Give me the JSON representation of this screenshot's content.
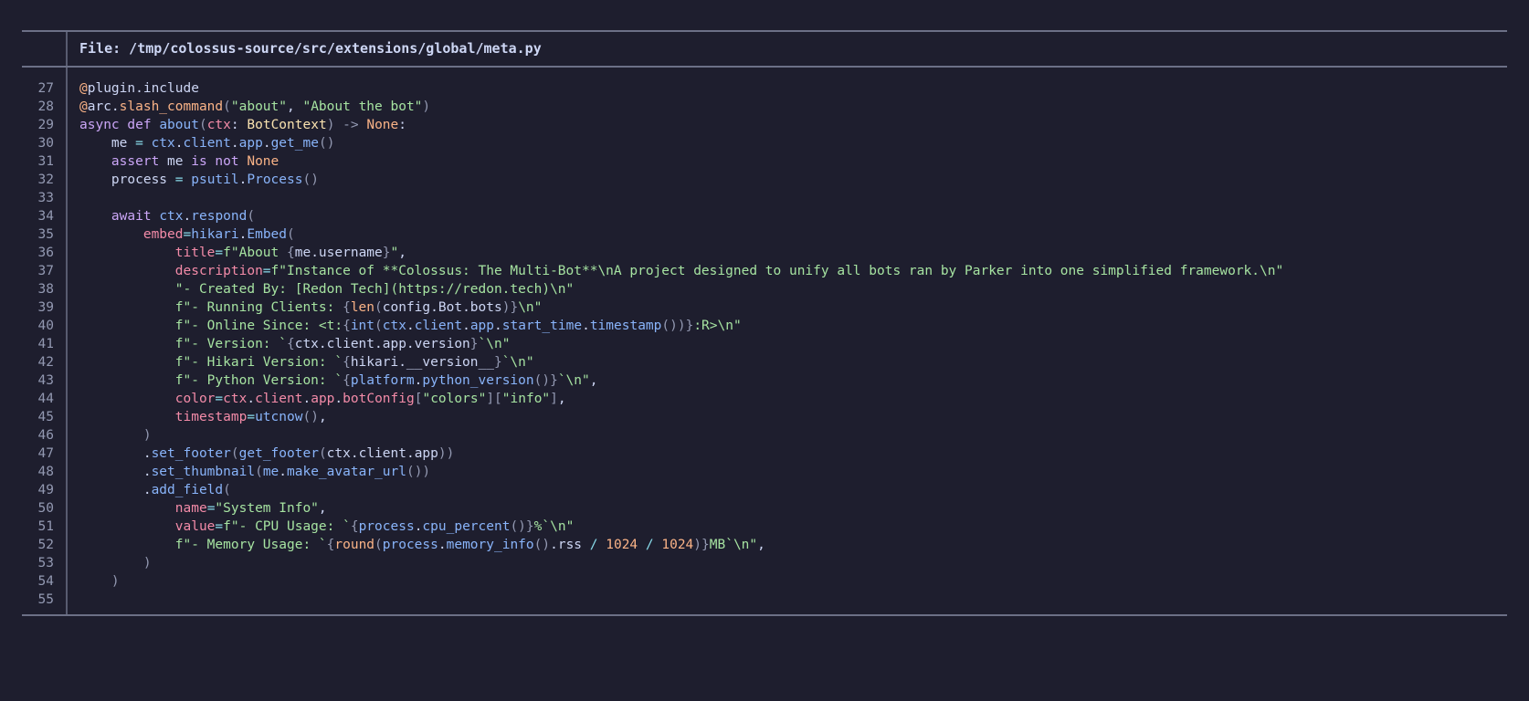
{
  "header": {
    "file_label": "File: /tmp/colossus-source/src/extensions/global/meta.py"
  },
  "code": [
    {
      "n": "27",
      "tokens": [
        [
          "@",
          "deco"
        ],
        [
          "plugin.include",
          "text"
        ]
      ]
    },
    {
      "n": "28",
      "tokens": [
        [
          "@",
          "deco"
        ],
        [
          "arc.",
          "text"
        ],
        [
          "slash_command",
          "deco"
        ],
        [
          "(",
          "punc"
        ],
        [
          "\"about\"",
          "str"
        ],
        [
          ", ",
          "text"
        ],
        [
          "\"About the bot\"",
          "str"
        ],
        [
          ")",
          "punc"
        ]
      ]
    },
    {
      "n": "29",
      "tokens": [
        [
          "async def ",
          "kw"
        ],
        [
          "about",
          "fn"
        ],
        [
          "(",
          "punc"
        ],
        [
          "ctx",
          "param"
        ],
        [
          ": ",
          "text"
        ],
        [
          "BotContext",
          "type"
        ],
        [
          ") -> ",
          "punc"
        ],
        [
          "None",
          "const"
        ],
        [
          ":",
          "text"
        ]
      ]
    },
    {
      "n": "30",
      "tokens": [
        [
          "    me ",
          "text"
        ],
        [
          "= ",
          "op"
        ],
        [
          "ctx",
          "attr"
        ],
        [
          ".",
          "text"
        ],
        [
          "client",
          "attr"
        ],
        [
          ".",
          "text"
        ],
        [
          "app",
          "attr"
        ],
        [
          ".",
          "text"
        ],
        [
          "get_me",
          "fn"
        ],
        [
          "()",
          "punc"
        ]
      ]
    },
    {
      "n": "31",
      "tokens": [
        [
          "    ",
          "text"
        ],
        [
          "assert ",
          "kw"
        ],
        [
          "me ",
          "text"
        ],
        [
          "is not ",
          "kw"
        ],
        [
          "None",
          "const"
        ]
      ]
    },
    {
      "n": "32",
      "tokens": [
        [
          "    process ",
          "text"
        ],
        [
          "= ",
          "op"
        ],
        [
          "psutil",
          "attr"
        ],
        [
          ".",
          "text"
        ],
        [
          "Process",
          "fn"
        ],
        [
          "()",
          "punc"
        ]
      ]
    },
    {
      "n": "33",
      "tokens": []
    },
    {
      "n": "34",
      "tokens": [
        [
          "    ",
          "text"
        ],
        [
          "await ",
          "kw"
        ],
        [
          "ctx",
          "attr"
        ],
        [
          ".",
          "text"
        ],
        [
          "respond",
          "fn"
        ],
        [
          "(",
          "punc"
        ]
      ]
    },
    {
      "n": "35",
      "tokens": [
        [
          "        ",
          "text"
        ],
        [
          "embed",
          "param"
        ],
        [
          "=",
          "op"
        ],
        [
          "hikari",
          "attr"
        ],
        [
          ".",
          "text"
        ],
        [
          "Embed",
          "fn"
        ],
        [
          "(",
          "punc"
        ]
      ]
    },
    {
      "n": "36",
      "tokens": [
        [
          "            ",
          "text"
        ],
        [
          "title",
          "param"
        ],
        [
          "=",
          "op"
        ],
        [
          "f\"About ",
          "str"
        ],
        [
          "{",
          "punc"
        ],
        [
          "me.username",
          "text"
        ],
        [
          "}",
          "punc"
        ],
        [
          "\"",
          "str"
        ],
        [
          ",",
          "text"
        ]
      ]
    },
    {
      "n": "37",
      "tokens": [
        [
          "            ",
          "text"
        ],
        [
          "description",
          "param"
        ],
        [
          "=",
          "op"
        ],
        [
          "f\"Instance of **Colossus: The Multi-Bot**\\nA project designed to unify all bots ran by Parker into one simplified framework.\\n\"",
          "str"
        ]
      ]
    },
    {
      "n": "38",
      "tokens": [
        [
          "            ",
          "text"
        ],
        [
          "\"- Created By: [Redon Tech](https://redon.tech)\\n\"",
          "str"
        ]
      ]
    },
    {
      "n": "39",
      "tokens": [
        [
          "            ",
          "text"
        ],
        [
          "f\"- Running Clients: ",
          "str"
        ],
        [
          "{",
          "punc"
        ],
        [
          "len",
          "builtin"
        ],
        [
          "(",
          "punc"
        ],
        [
          "config.Bot.bots",
          "text"
        ],
        [
          ")}",
          "punc"
        ],
        [
          "\\n\"",
          "str"
        ]
      ]
    },
    {
      "n": "40",
      "tokens": [
        [
          "            ",
          "text"
        ],
        [
          "f\"- Online Since: <t:",
          "str"
        ],
        [
          "{",
          "punc"
        ],
        [
          "int",
          "fn"
        ],
        [
          "(",
          "punc"
        ],
        [
          "ctx",
          "attr"
        ],
        [
          ".",
          "text"
        ],
        [
          "client",
          "attr"
        ],
        [
          ".",
          "text"
        ],
        [
          "app",
          "attr"
        ],
        [
          ".",
          "text"
        ],
        [
          "start_time",
          "attr"
        ],
        [
          ".",
          "text"
        ],
        [
          "timestamp",
          "fn"
        ],
        [
          "())}",
          "punc"
        ],
        [
          ":R>\\n\"",
          "str"
        ]
      ]
    },
    {
      "n": "41",
      "tokens": [
        [
          "            ",
          "text"
        ],
        [
          "f\"- Version: `",
          "str"
        ],
        [
          "{",
          "punc"
        ],
        [
          "ctx.client.app.version",
          "text"
        ],
        [
          "}",
          "punc"
        ],
        [
          "`\\n\"",
          "str"
        ]
      ]
    },
    {
      "n": "42",
      "tokens": [
        [
          "            ",
          "text"
        ],
        [
          "f\"- Hikari Version: `",
          "str"
        ],
        [
          "{",
          "punc"
        ],
        [
          "hikari.__version__",
          "text"
        ],
        [
          "}",
          "punc"
        ],
        [
          "`\\n\"",
          "str"
        ]
      ]
    },
    {
      "n": "43",
      "tokens": [
        [
          "            ",
          "text"
        ],
        [
          "f\"- Python Version: `",
          "str"
        ],
        [
          "{",
          "punc"
        ],
        [
          "platform",
          "attr"
        ],
        [
          ".",
          "text"
        ],
        [
          "python_version",
          "fn"
        ],
        [
          "()}",
          "punc"
        ],
        [
          "`\\n\"",
          "str"
        ],
        [
          ",",
          "text"
        ]
      ]
    },
    {
      "n": "44",
      "tokens": [
        [
          "            ",
          "text"
        ],
        [
          "color",
          "param"
        ],
        [
          "=",
          "op"
        ],
        [
          "ctx",
          "var"
        ],
        [
          ".",
          "text"
        ],
        [
          "client",
          "var"
        ],
        [
          ".",
          "text"
        ],
        [
          "app",
          "var"
        ],
        [
          ".",
          "text"
        ],
        [
          "botConfig",
          "var"
        ],
        [
          "[",
          "punc"
        ],
        [
          "\"colors\"",
          "str"
        ],
        [
          "][",
          "punc"
        ],
        [
          "\"info\"",
          "str"
        ],
        [
          "]",
          "punc"
        ],
        [
          ",",
          "text"
        ]
      ]
    },
    {
      "n": "45",
      "tokens": [
        [
          "            ",
          "text"
        ],
        [
          "timestamp",
          "param"
        ],
        [
          "=",
          "op"
        ],
        [
          "utcnow",
          "fn"
        ],
        [
          "()",
          "punc"
        ],
        [
          ",",
          "text"
        ]
      ]
    },
    {
      "n": "46",
      "tokens": [
        [
          "        ",
          "text"
        ],
        [
          ")",
          "punc"
        ]
      ]
    },
    {
      "n": "47",
      "tokens": [
        [
          "        ",
          "text"
        ],
        [
          ".",
          "text"
        ],
        [
          "set_footer",
          "fn"
        ],
        [
          "(",
          "punc"
        ],
        [
          "get_footer",
          "fn"
        ],
        [
          "(",
          "punc"
        ],
        [
          "ctx.client.app",
          "text"
        ],
        [
          "))",
          "punc"
        ]
      ]
    },
    {
      "n": "48",
      "tokens": [
        [
          "        ",
          "text"
        ],
        [
          ".",
          "text"
        ],
        [
          "set_thumbnail",
          "fn"
        ],
        [
          "(",
          "punc"
        ],
        [
          "me",
          "attr"
        ],
        [
          ".",
          "text"
        ],
        [
          "make_avatar_url",
          "fn"
        ],
        [
          "())",
          "punc"
        ]
      ]
    },
    {
      "n": "49",
      "tokens": [
        [
          "        ",
          "text"
        ],
        [
          ".",
          "text"
        ],
        [
          "add_field",
          "fn"
        ],
        [
          "(",
          "punc"
        ]
      ]
    },
    {
      "n": "50",
      "tokens": [
        [
          "            ",
          "text"
        ],
        [
          "name",
          "param"
        ],
        [
          "=",
          "op"
        ],
        [
          "\"System Info\"",
          "str"
        ],
        [
          ",",
          "text"
        ]
      ]
    },
    {
      "n": "51",
      "tokens": [
        [
          "            ",
          "text"
        ],
        [
          "value",
          "param"
        ],
        [
          "=",
          "op"
        ],
        [
          "f\"- CPU Usage: `",
          "str"
        ],
        [
          "{",
          "punc"
        ],
        [
          "process",
          "attr"
        ],
        [
          ".",
          "text"
        ],
        [
          "cpu_percent",
          "fn"
        ],
        [
          "()}",
          "punc"
        ],
        [
          "%`\\n\"",
          "str"
        ]
      ]
    },
    {
      "n": "52",
      "tokens": [
        [
          "            ",
          "text"
        ],
        [
          "f\"- Memory Usage: `",
          "str"
        ],
        [
          "{",
          "punc"
        ],
        [
          "round",
          "builtin"
        ],
        [
          "(",
          "punc"
        ],
        [
          "process",
          "attr"
        ],
        [
          ".",
          "text"
        ],
        [
          "memory_info",
          "fn"
        ],
        [
          "()",
          "punc"
        ],
        [
          ".rss ",
          "text"
        ],
        [
          "/ ",
          "op"
        ],
        [
          "1024",
          "num"
        ],
        [
          " / ",
          "op"
        ],
        [
          "1024",
          "num"
        ],
        [
          ")}",
          "punc"
        ],
        [
          "MB`\\n\"",
          "str"
        ],
        [
          ",",
          "text"
        ]
      ]
    },
    {
      "n": "53",
      "tokens": [
        [
          "        ",
          "text"
        ],
        [
          ")",
          "punc"
        ]
      ]
    },
    {
      "n": "54",
      "tokens": [
        [
          "    ",
          "text"
        ],
        [
          ")",
          "punc"
        ]
      ]
    },
    {
      "n": "55",
      "tokens": []
    }
  ]
}
